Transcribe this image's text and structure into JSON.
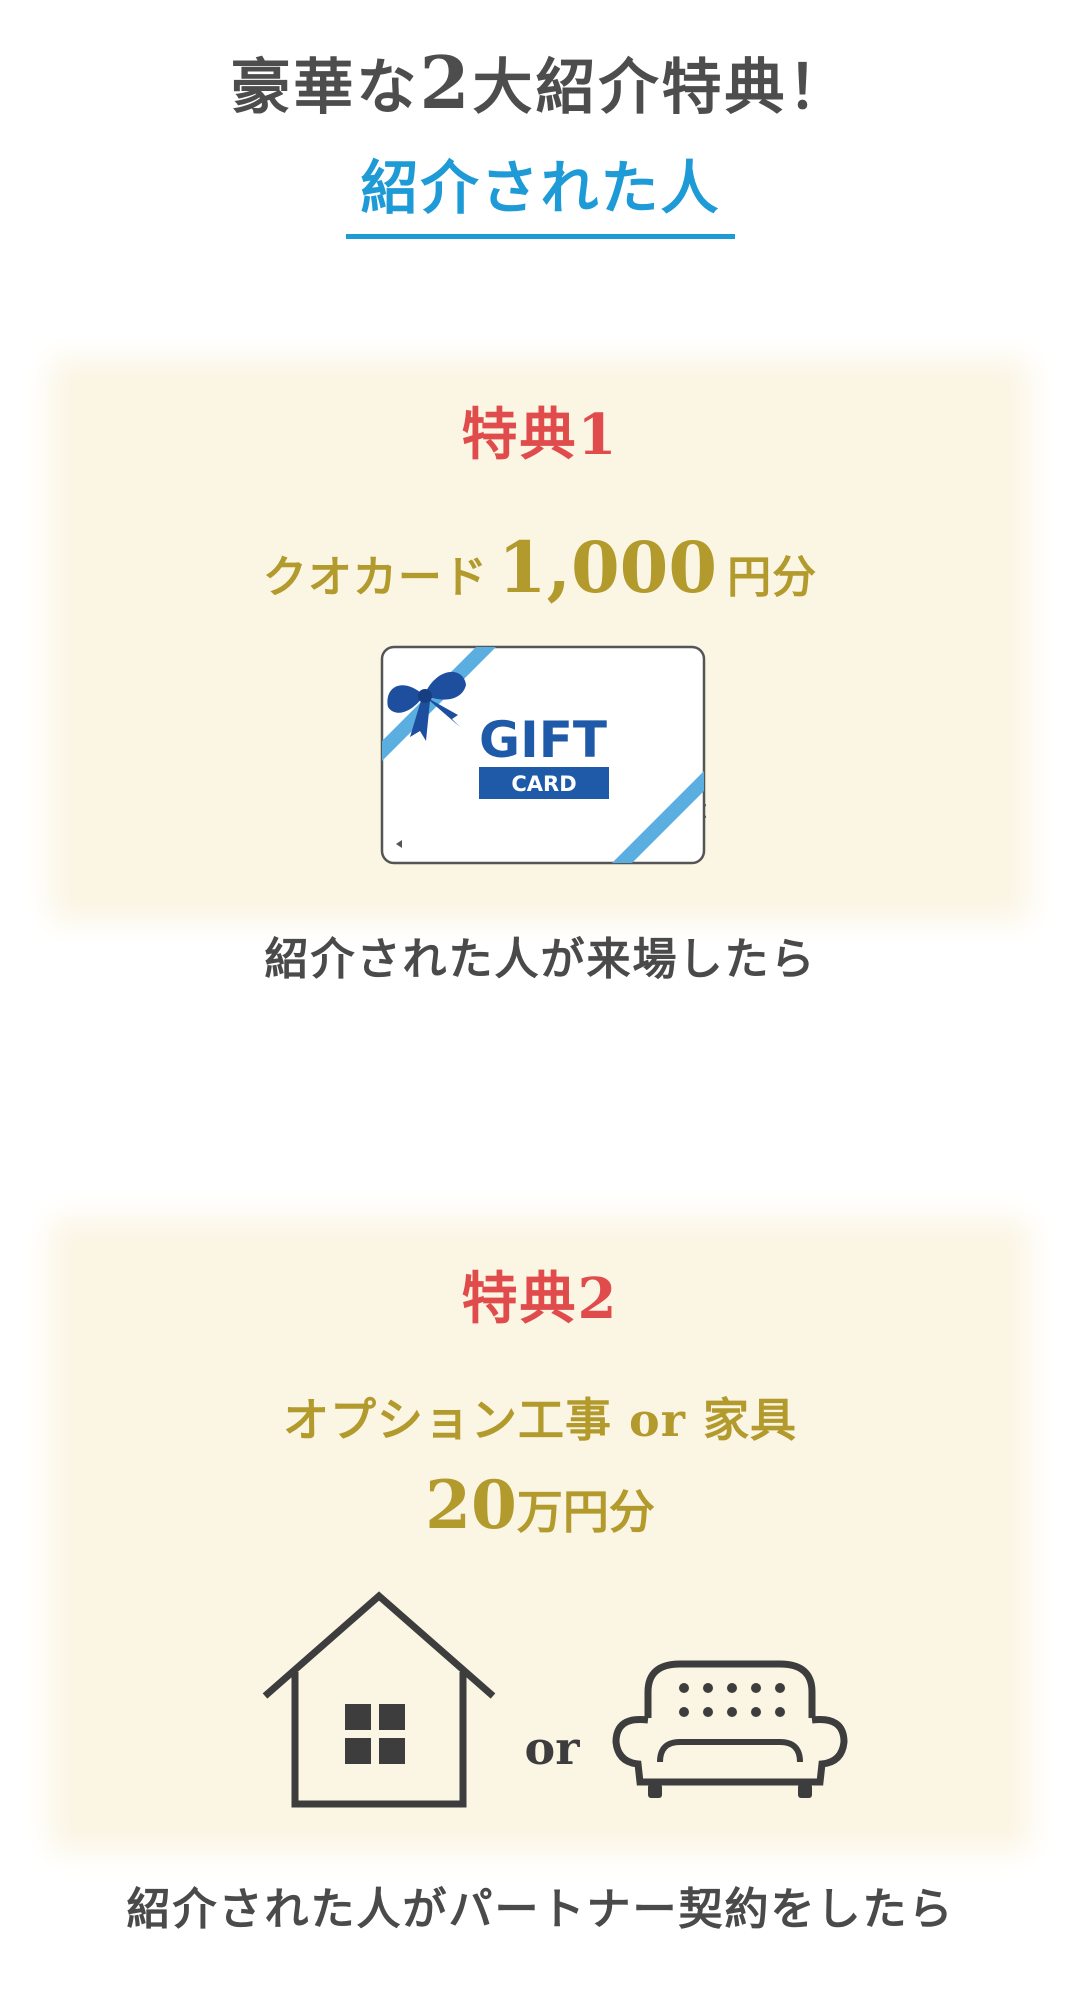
{
  "header": {
    "title_prefix": "豪華な",
    "title_number": "2",
    "title_suffix": "大紹介特典！",
    "subtitle": "紹介された人"
  },
  "benefit_1": {
    "heading": "特典1",
    "prize_name": "クオカード",
    "prize_amount": "1,000",
    "prize_unit": "円分",
    "card_title": "GIFT",
    "card_subtitle": "CARD",
    "caption": "紹介された人が来場したら"
  },
  "benefit_2": {
    "heading": "特典2",
    "prize_line": "オプション工事 or 家具",
    "prize_amount": "20",
    "prize_unit": "万円分",
    "or_label": "or",
    "caption": "紹介された人がパートナー契約をしたら"
  },
  "colors": {
    "accent_blue": "#1e9bd7",
    "heading_red": "#e04c4c",
    "gold": "#b39a2c",
    "box_background": "#fbf5e4",
    "card_blue": "#1e5aa8",
    "ribbon_blue": "#5aaee0"
  },
  "icons": [
    "gift-card-icon",
    "ribbon-bow-icon",
    "house-icon",
    "sofa-icon"
  ]
}
